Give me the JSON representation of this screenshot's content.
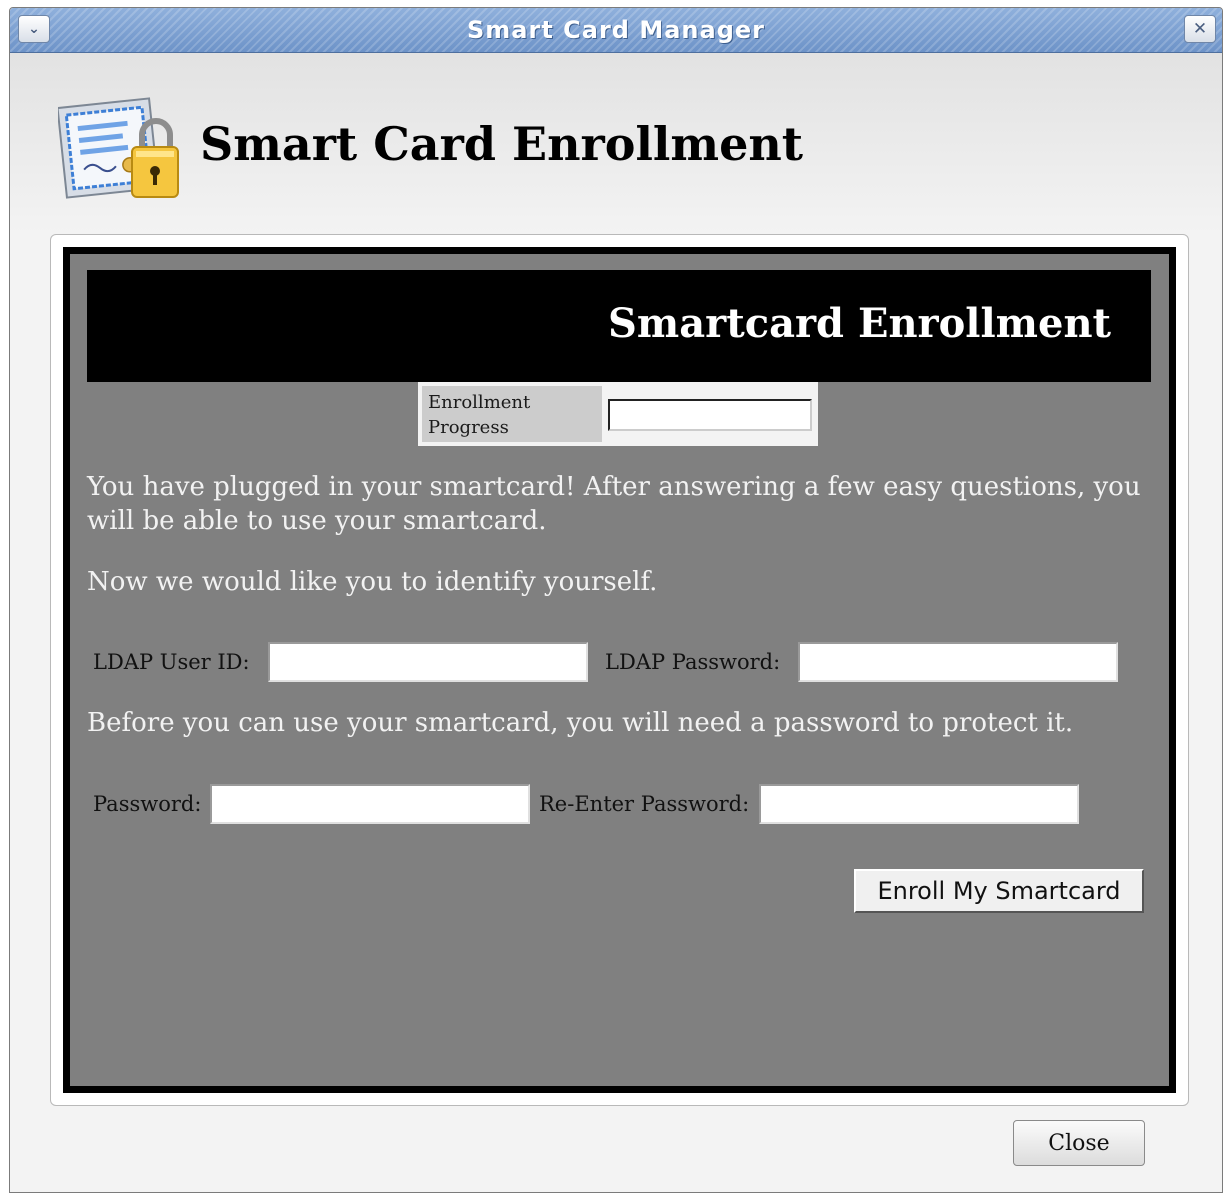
{
  "window": {
    "title": "Smart Card Manager"
  },
  "header": {
    "title": "Smart Card Enrollment",
    "icon": "certificate-lock-icon"
  },
  "page": {
    "banner_title": "Smartcard Enrollment",
    "progress": {
      "label": "Enrollment Progress",
      "value": 0
    },
    "intro_text": "You have plugged in your smartcard! After answering a few easy questions, you will be able to use your smartcard.",
    "identify_text": "Now we would like you to identify yourself.",
    "ldap_user_label": "LDAP User ID:",
    "ldap_user_value": "",
    "ldap_password_label": "LDAP Password:",
    "ldap_password_value": "",
    "password_text": "Before you can use your smartcard, you will need a password to protect it.",
    "password_label": "Password:",
    "password_value": "",
    "reenter_label": "Re-Enter Password:",
    "reenter_value": "",
    "enroll_button": "Enroll My Smartcard"
  },
  "footer": {
    "close_button": "Close"
  },
  "colors": {
    "titlebar": "#7aa0d4",
    "page_background": "#808080",
    "banner": "#000000"
  }
}
